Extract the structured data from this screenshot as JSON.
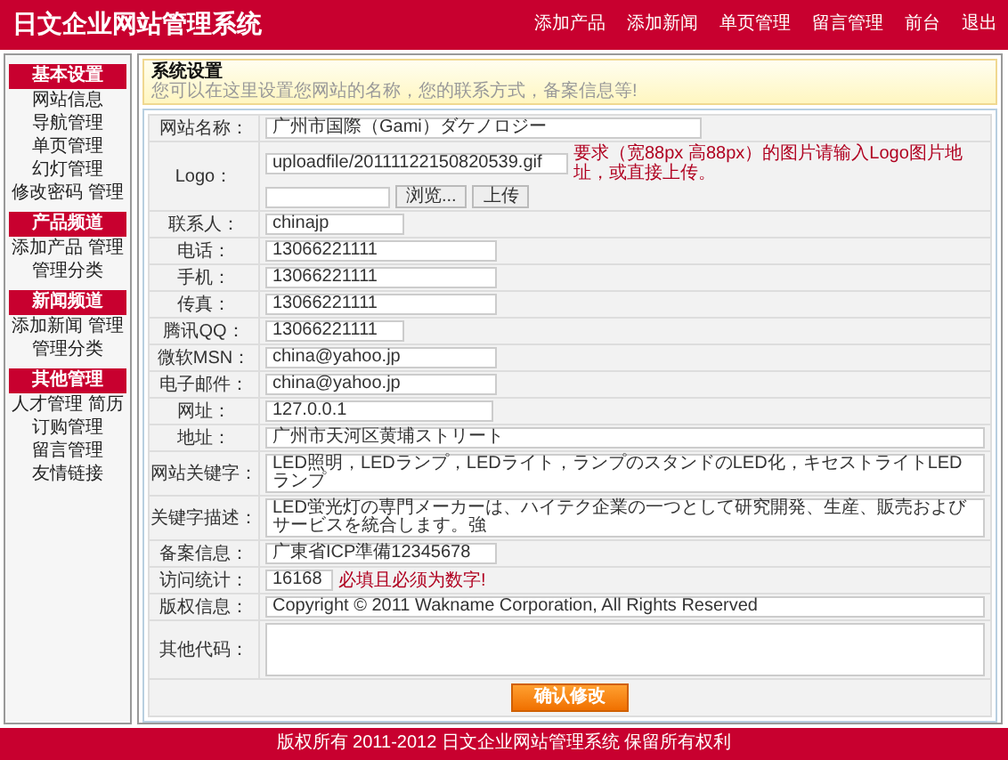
{
  "header": {
    "title": "日文企业网站管理系统",
    "nav": [
      "添加产品",
      "添加新闻",
      "单页管理",
      "留言管理",
      "前台",
      "退出"
    ]
  },
  "sidebar": [
    {
      "title": "基本设置",
      "lines": [
        [
          "网站信息"
        ],
        [
          "导航管理"
        ],
        [
          "单页管理"
        ],
        [
          "幻灯管理"
        ],
        [
          "修改密码",
          "管理"
        ]
      ]
    },
    {
      "title": "产品频道",
      "lines": [
        [
          "添加产品",
          "管理"
        ],
        [
          "管理分类"
        ]
      ]
    },
    {
      "title": "新闻频道",
      "lines": [
        [
          "添加新闻",
          "管理"
        ],
        [
          "管理分类"
        ]
      ]
    },
    {
      "title": "其他管理",
      "lines": [
        [
          "人才管理",
          "简历"
        ],
        [
          "订购管理"
        ],
        [
          "留言管理"
        ],
        [
          "友情链接"
        ]
      ]
    }
  ],
  "notice": {
    "title": "系统设置",
    "text": "您可以在这里设置您网站的名称，您的联系方式，备案信息等!"
  },
  "form": {
    "rows": [
      {
        "kind": "long",
        "label": "网站名称：",
        "value": "广州市国際（Gami）ダケノロジー"
      },
      {
        "kind": "logo",
        "label": "Logo：",
        "value": "uploadfile/20111122150820539.gif",
        "hint": "要求（宽88px 高88px）的图片请输入Logo图片地址，或直接上传。",
        "buttons": [
          "浏览...",
          "上传"
        ]
      },
      {
        "kind": "short",
        "label": "联系人：",
        "value": "chinajp"
      },
      {
        "kind": "medium",
        "label": "电话：",
        "value": "13066221111"
      },
      {
        "kind": "medium",
        "label": "手机：",
        "value": "13066221111"
      },
      {
        "kind": "medium",
        "label": "传真：",
        "value": "13066221111"
      },
      {
        "kind": "short",
        "label": "腾讯QQ：",
        "value": "13066221111"
      },
      {
        "kind": "medium",
        "label": "微软MSN：",
        "value": "china@yahoo.jp"
      },
      {
        "kind": "medium",
        "label": "电子邮件：",
        "value": "china@yahoo.jp"
      },
      {
        "kind": "url",
        "label": "网址：",
        "value": "127.0.0.1"
      },
      {
        "kind": "wide",
        "label": "地址：",
        "value": "广州市天河区黄埔ストリート"
      },
      {
        "kind": "wide",
        "label": "网站关键字：",
        "value": "LED照明，LEDランプ，LEDライト，ランプのスタンドのLED化，キセストライトLEDランプ"
      },
      {
        "kind": "wide",
        "label": "关键字描述：",
        "value": "LED蛍光灯の専門メーカーは、ハイテク企業の一つとして研究開発、生産、販売およびサービスを統合します。強"
      },
      {
        "kind": "medium",
        "label": "备案信息：",
        "value": "广東省ICP準備12345678"
      },
      {
        "kind": "stats",
        "label": "访问统计：",
        "value": "16168",
        "hint": "必填且必须为数字!"
      },
      {
        "kind": "wide",
        "label": "版权信息：",
        "value": "Copyright © 2011 Wakname Corporation, All Rights Reserved"
      },
      {
        "kind": "textarea",
        "label": "其他代码："
      }
    ],
    "submit": "确认修改"
  },
  "footer": "版权所有 2011-2012 日文企业网站管理系统 保留所有权利"
}
